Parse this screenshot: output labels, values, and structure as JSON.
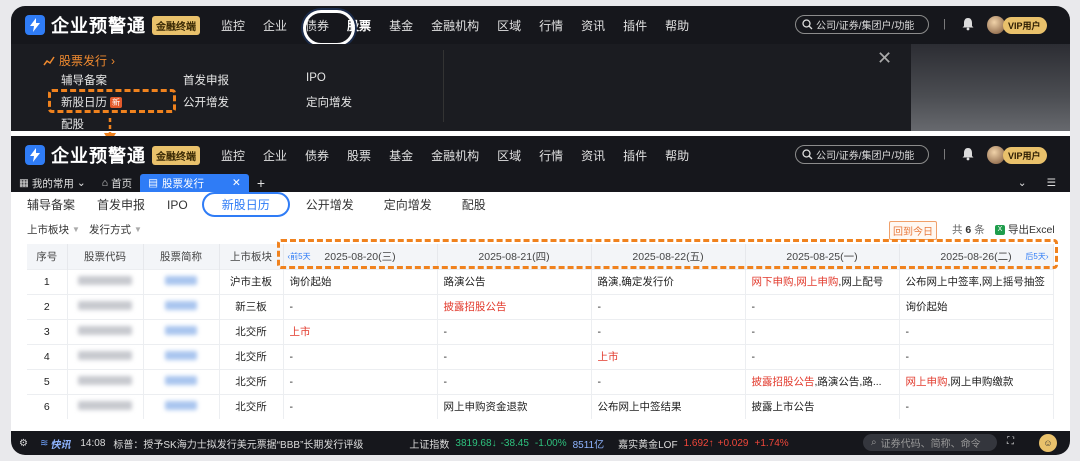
{
  "app": {
    "name": "企业预警通",
    "badge": "金融终端"
  },
  "nav": {
    "items": [
      "监控",
      "企业",
      "债券",
      "股票",
      "基金",
      "金融机构",
      "区域",
      "行情",
      "资讯",
      "插件",
      "帮助"
    ]
  },
  "search": {
    "placeholder": "公司/证券/集团户/功能"
  },
  "user": {
    "vip": "VIP用户"
  },
  "dropdown": {
    "title": "股票发行",
    "col1": [
      "辅导备案",
      "新股日历",
      "配股"
    ],
    "new_tag": "新",
    "col2": [
      "首发申报",
      "公开增发"
    ],
    "col3": [
      "IPO",
      "定向增发"
    ]
  },
  "tabs": {
    "favorites": "我的常用",
    "home": "首页",
    "active": "股票发行"
  },
  "subtabs": [
    "辅导备案",
    "首发申报",
    "IPO",
    "新股日历",
    "公开增发",
    "定向增发",
    "配股"
  ],
  "filters": {
    "board": "上市板块",
    "method": "发行方式",
    "back_today": "回到今日",
    "count_prefix": "共",
    "count": "6",
    "count_suffix": "条",
    "export": "导出Excel"
  },
  "table": {
    "headers": [
      "序号",
      "股票代码",
      "股票简称",
      "上市板块"
    ],
    "prev": "前5天",
    "next": "后5天",
    "dates": [
      "2025-08-20(三)",
      "2025-08-21(四)",
      "2025-08-22(五)",
      "2025-08-25(一)",
      "2025-08-26(二)"
    ],
    "rows": [
      {
        "no": "1",
        "board": "沪市主板",
        "d": [
          [
            "询价起始",
            ""
          ],
          [
            "路演公告",
            ""
          ],
          [
            "路演,确定发行价",
            ""
          ],
          [
            "网下申购,网上申购,网上配号",
            "mix1"
          ],
          [
            "公布网上中签率,网上摇号抽签",
            ""
          ]
        ]
      },
      {
        "no": "2",
        "board": "新三板",
        "d": [
          [
            "-",
            ""
          ],
          [
            "披露招股公告",
            "red"
          ],
          [
            "-",
            ""
          ],
          [
            "-",
            ""
          ],
          [
            "询价起始",
            ""
          ]
        ]
      },
      {
        "no": "3",
        "board": "北交所",
        "d": [
          [
            "上市",
            "red"
          ],
          [
            "-",
            ""
          ],
          [
            "-",
            ""
          ],
          [
            "-",
            ""
          ],
          [
            "-",
            ""
          ]
        ]
      },
      {
        "no": "4",
        "board": "北交所",
        "d": [
          [
            "-",
            ""
          ],
          [
            "-",
            ""
          ],
          [
            "上市",
            "red"
          ],
          [
            "-",
            ""
          ],
          [
            "-",
            ""
          ]
        ]
      },
      {
        "no": "5",
        "board": "北交所",
        "d": [
          [
            "-",
            ""
          ],
          [
            "-",
            ""
          ],
          [
            "-",
            ""
          ],
          [
            "披露招股公告,路演公告,路...",
            "mix2"
          ],
          [
            "网上申购,网上申购缴款",
            "mix3"
          ]
        ]
      },
      {
        "no": "6",
        "board": "北交所",
        "d": [
          [
            "-",
            ""
          ],
          [
            "网上申购资金退款",
            ""
          ],
          [
            "公布网上中签结果",
            ""
          ],
          [
            "披露上市公告",
            ""
          ],
          [
            "-",
            ""
          ]
        ]
      }
    ]
  },
  "status": {
    "news_brand": "快讯",
    "time": "14:08",
    "headline": "标普：授予SK海力士拟发行美元票据“BBB”长期发行评级",
    "index_name": "上证指数",
    "index_val": "3819.68",
    "index_chg": "-38.45",
    "index_pct": "-1.00%",
    "index_vol": "8511亿",
    "fund_name": "嘉实黄金LOF",
    "fund_val": "1.692",
    "fund_chg": "+0.029",
    "fund_pct": "+1.74%",
    "search_placeholder": "证券代码、简称、命令"
  },
  "colors": {
    "accent": "#2f7cf6",
    "highlight": "#f0821e",
    "red": "#e23b2e",
    "green": "#2ec27e"
  }
}
